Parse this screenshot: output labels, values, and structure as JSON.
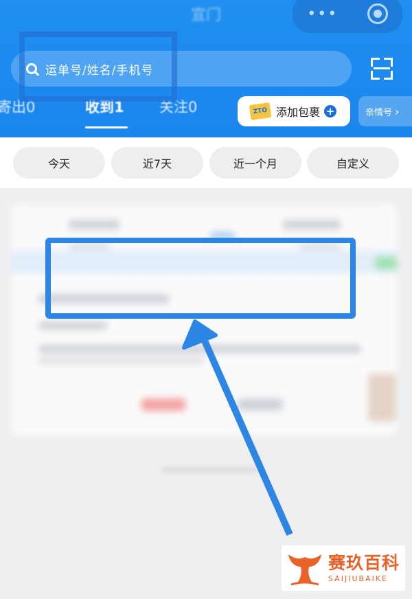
{
  "header": {
    "title": "宣门",
    "capsule": {
      "more_label": "•••",
      "more_icon": "more-dots-icon",
      "close_icon": "target-icon"
    },
    "search": {
      "placeholder": "运单号/姓名/手机号",
      "icon": "search-icon"
    },
    "scan_icon": "scan-icon",
    "tabs": [
      {
        "label": "寄出0",
        "active": false
      },
      {
        "label": "收到1",
        "active": true
      },
      {
        "label": "关注0",
        "active": false
      }
    ],
    "add_package": {
      "label": "添加包裹",
      "badge": "ZTO",
      "icon": "plus-circle-icon"
    },
    "family_button": {
      "label": "亲情号",
      "icon": "chevron-right-icon",
      "chevron": "›"
    }
  },
  "filters": [
    {
      "label": "今天"
    },
    {
      "label": "近7天"
    },
    {
      "label": "近一个月"
    },
    {
      "label": "自定义"
    }
  ],
  "colors": {
    "header_blue": "#1f8ff0",
    "annotation_blue": "#2d86e3",
    "watermark_orange": "#e8622a"
  },
  "watermark": {
    "name_cn": "赛玖百科",
    "name_en": "SAIJIUBAIKE"
  }
}
